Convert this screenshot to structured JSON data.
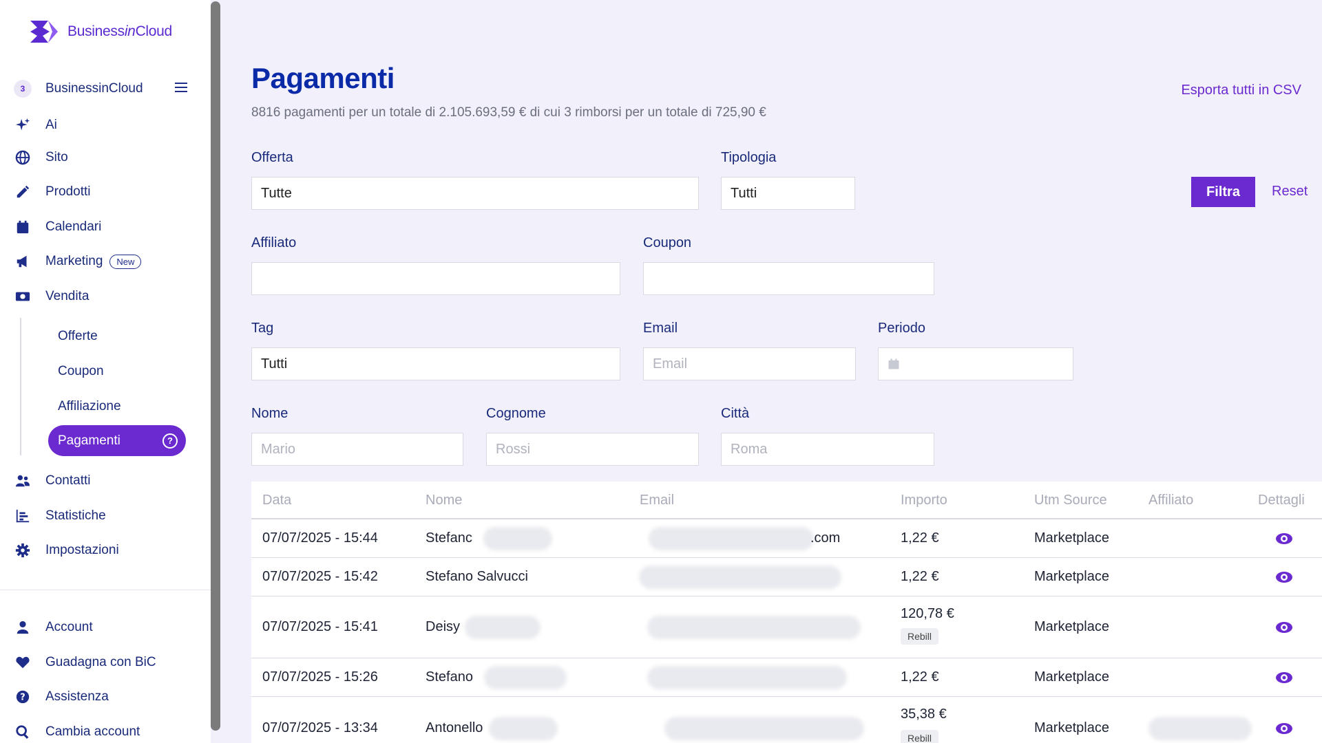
{
  "brand": {
    "name_prefix": "Business",
    "name_italic": "in",
    "name_suffix": "Cloud",
    "accent": "#6a2ad0"
  },
  "sidebar": {
    "org_name": "BusinessinCloud",
    "items": [
      {
        "label": "Ai",
        "icon": "sparkles-icon"
      },
      {
        "label": "Sito",
        "icon": "globe-icon"
      },
      {
        "label": "Prodotti",
        "icon": "pencil-icon"
      },
      {
        "label": "Calendari",
        "icon": "calendar-icon"
      },
      {
        "label": "Marketing",
        "icon": "megaphone-icon",
        "badge": "New"
      },
      {
        "label": "Vendita",
        "icon": "money-icon"
      }
    ],
    "sub_items": [
      {
        "label": "Offerte"
      },
      {
        "label": "Coupon"
      },
      {
        "label": "Affiliazione"
      },
      {
        "label": "Pagamenti",
        "active": true
      }
    ],
    "items_after": [
      {
        "label": "Contatti",
        "icon": "users-icon"
      },
      {
        "label": "Statistiche",
        "icon": "chart-icon"
      },
      {
        "label": "Impostazioni",
        "icon": "gear-icon"
      }
    ],
    "bottom_items": [
      {
        "label": "Account",
        "icon": "user-icon"
      },
      {
        "label": "Guadagna con BiC",
        "icon": "heart-icon"
      },
      {
        "label": "Assistenza",
        "icon": "question-icon"
      },
      {
        "label": "Cambia account",
        "icon": "search-icon"
      }
    ]
  },
  "page": {
    "title": "Pagamenti",
    "summary": "8816 pagamenti per un totale di 2.105.693,59 € di cui 3 rimborsi per un totale di 725,90 €",
    "export_label": "Esporta tutti in CSV"
  },
  "filters": {
    "offerta": {
      "label": "Offerta",
      "value": "Tutte"
    },
    "tipologia": {
      "label": "Tipologia",
      "value": "Tutti"
    },
    "affiliato": {
      "label": "Affiliato",
      "value": ""
    },
    "coupon": {
      "label": "Coupon",
      "value": ""
    },
    "tag": {
      "label": "Tag",
      "value": "Tutti"
    },
    "email": {
      "label": "Email",
      "placeholder": "Email"
    },
    "periodo": {
      "label": "Periodo",
      "value": ""
    },
    "nome": {
      "label": "Nome",
      "placeholder": "Mario"
    },
    "cognome": {
      "label": "Cognome",
      "placeholder": "Rossi"
    },
    "citta": {
      "label": "Città",
      "placeholder": "Roma"
    },
    "filtra_label": "Filtra",
    "reset_label": "Reset"
  },
  "table": {
    "columns": [
      "Data",
      "Nome",
      "Email",
      "Importo",
      "Utm Source",
      "Affiliato",
      "Dettagli"
    ],
    "rows": [
      {
        "data": "07/07/2025 - 15:44",
        "nome": "Stefanc",
        "email": ".com",
        "importo": "1,22 €",
        "badge": "",
        "utm": "Marketplace"
      },
      {
        "data": "07/07/2025 - 15:42",
        "nome": "Stefano Salvucci",
        "email": "",
        "importo": "1,22 €",
        "badge": "",
        "utm": "Marketplace"
      },
      {
        "data": "07/07/2025 - 15:41",
        "nome": "Deisy",
        "email": "",
        "importo": "120,78 €",
        "badge": "Rebill",
        "utm": "Marketplace"
      },
      {
        "data": "07/07/2025 - 15:26",
        "nome": "Stefano",
        "email": "",
        "importo": "1,22 €",
        "badge": "",
        "utm": "Marketplace"
      },
      {
        "data": "07/07/2025 - 13:34",
        "nome": "Antonello",
        "email": "",
        "importo": "35,38 €",
        "badge": "Rebill",
        "utm": "Marketplace"
      }
    ]
  }
}
